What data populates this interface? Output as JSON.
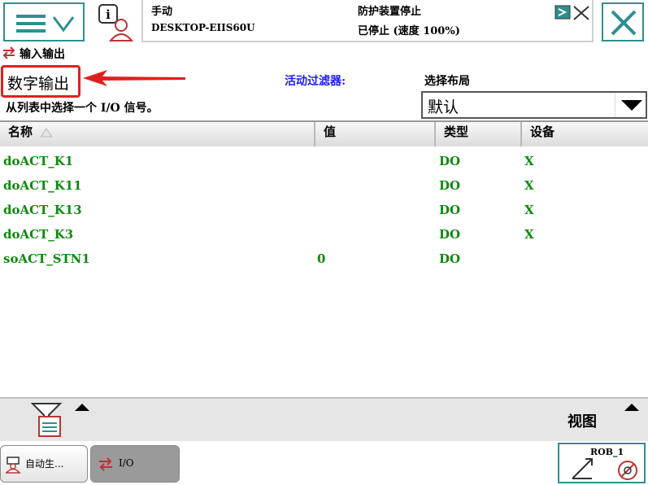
{
  "status_bar": {
    "mode": "手动",
    "device": "DESKTOP-EIIS60U",
    "guard_status": "防护装置停止",
    "run_status": "已停止 (速度 100%)"
  },
  "breadcrumb": {
    "label": "输入输出"
  },
  "view": {
    "title": "数字输出",
    "filter_label": "活动过滤器:",
    "layout_label": "选择布局",
    "instruction": "从列表中选择一个 I/O 信号。",
    "layout_value": "默认"
  },
  "table": {
    "headers": {
      "name": "名称",
      "value": "值",
      "type": "类型",
      "device": "设备"
    },
    "rows": [
      {
        "name": "doACT_K1",
        "value": "",
        "type": "DO",
        "device": "X"
      },
      {
        "name": "doACT_K11",
        "value": "",
        "type": "DO",
        "device": "X"
      },
      {
        "name": "doACT_K13",
        "value": "",
        "type": "DO",
        "device": "X"
      },
      {
        "name": "doACT_K3",
        "value": "",
        "type": "DO",
        "device": "X"
      },
      {
        "name": "soACT_STN1",
        "value": "0",
        "type": "DO",
        "device": ""
      }
    ]
  },
  "bottom_toolbar": {
    "view_label": "视图"
  },
  "taskbar": {
    "auto_label": "自动生...",
    "io_label": "I/O",
    "robot_label": "ROB_1"
  },
  "colors": {
    "accent_teal": "#2f8f8f",
    "signal_green": "#0e8a0e",
    "filter_blue": "#1a1aff",
    "highlight_red": "#e02020"
  }
}
